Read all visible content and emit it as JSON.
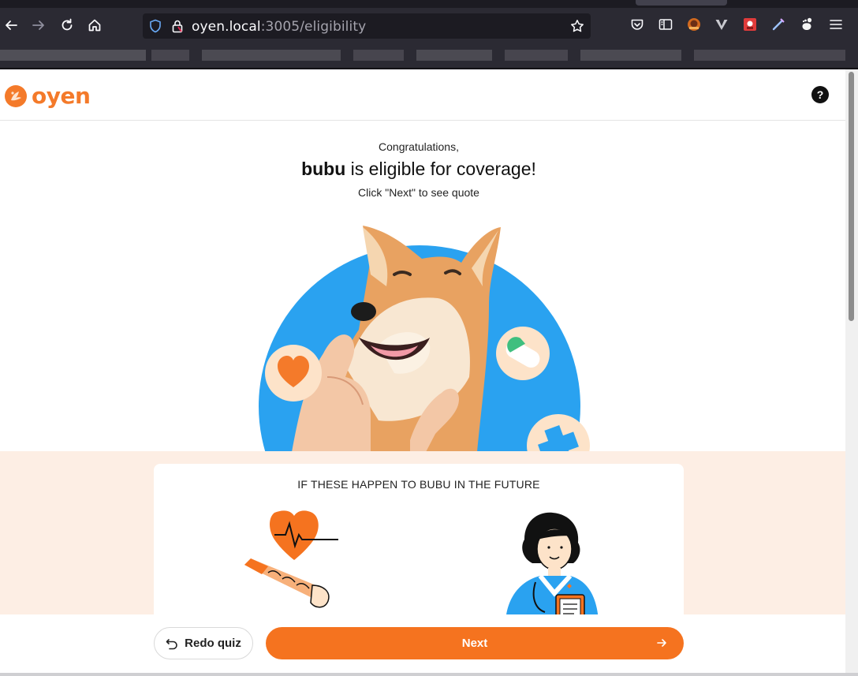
{
  "browser": {
    "url_host": "oyen.local",
    "url_path": ":3005/eligibility"
  },
  "header": {
    "brand": "oyen",
    "help_label": "?"
  },
  "intro": {
    "congrats": "Congratulations,",
    "pet_name": "bubu",
    "eligible_text": " is eligible for coverage!",
    "hint": "Click \"Next\" to see quote"
  },
  "card": {
    "title": "IF THESE HAPPEN TO BUBU IN THE FUTURE"
  },
  "footer": {
    "redo_label": "Redo quiz",
    "next_label": "Next"
  },
  "colors": {
    "brand_orange": "#f5731f",
    "peach_bg": "#fdeee4",
    "hero_blue": "#2aa2f0"
  }
}
